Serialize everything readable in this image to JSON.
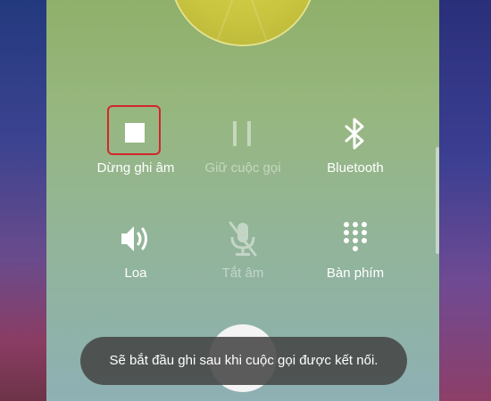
{
  "controls": {
    "record": {
      "label": "Dừng ghi âm",
      "icon": "stop-icon",
      "highlight_color": "#d3262c",
      "enabled": true
    },
    "hold": {
      "label": "Giữ cuộc gọi",
      "icon": "pause-icon",
      "enabled": false
    },
    "bluetooth": {
      "label": "Bluetooth",
      "icon": "bluetooth-icon",
      "enabled": true
    },
    "speaker": {
      "label": "Loa",
      "icon": "speaker-icon",
      "enabled": true
    },
    "mute": {
      "label": "Tắt âm",
      "icon": "mic-off-icon",
      "enabled": false
    },
    "keypad": {
      "label": "Bàn phím",
      "icon": "keypad-icon",
      "enabled": true
    }
  },
  "toast": {
    "message": "Sẽ bắt đầu ghi sau khi cuộc gọi được kết nối."
  }
}
